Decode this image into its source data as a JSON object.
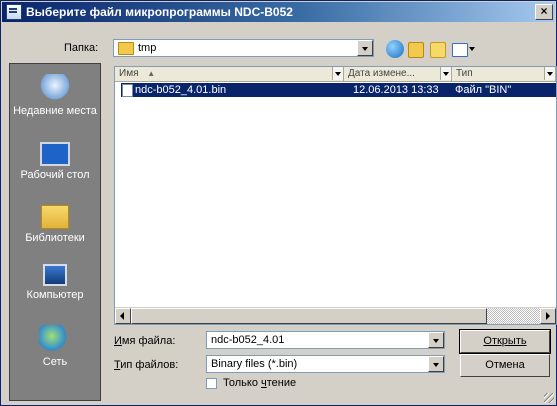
{
  "window": {
    "title": "Выберите файл микропрограммы NDC-B052",
    "close_glyph": "×"
  },
  "toolbar": {
    "folder_label": "Папка:",
    "folder_value": "tmp",
    "icons": [
      "back-icon",
      "up-folder-icon",
      "new-folder-icon",
      "views-menu-icon"
    ]
  },
  "places": [
    {
      "label": "Недавние места",
      "icon": "recent-places-icon"
    },
    {
      "label": "Рабочий стол",
      "icon": "desktop-icon"
    },
    {
      "label": "Библиотеки",
      "icon": "libraries-icon"
    },
    {
      "label": "Компьютер",
      "icon": "computer-icon"
    },
    {
      "label": "Сеть",
      "icon": "network-icon"
    }
  ],
  "columns": [
    "Имя",
    "Дата измене...",
    "Тип"
  ],
  "files": [
    {
      "name": "ndc-b052_4.01.bin",
      "date": "12.06.2013 13:33",
      "type": "Файл \"BIN\"",
      "selected": true
    }
  ],
  "filename": {
    "label": "Имя файла:",
    "value": "ndc-b052_4.01"
  },
  "filetype": {
    "label": "Тип файлов:",
    "value": "Binary files (*.bin)"
  },
  "readonly": {
    "label": "Только чтение",
    "checked": false
  },
  "buttons": {
    "open": "Открыть",
    "cancel": "Отмена"
  },
  "colors": {
    "selection": "#0a246a",
    "titlebar": "#0a246a",
    "face": "#d4d0c8",
    "places_bg": "#808080"
  }
}
